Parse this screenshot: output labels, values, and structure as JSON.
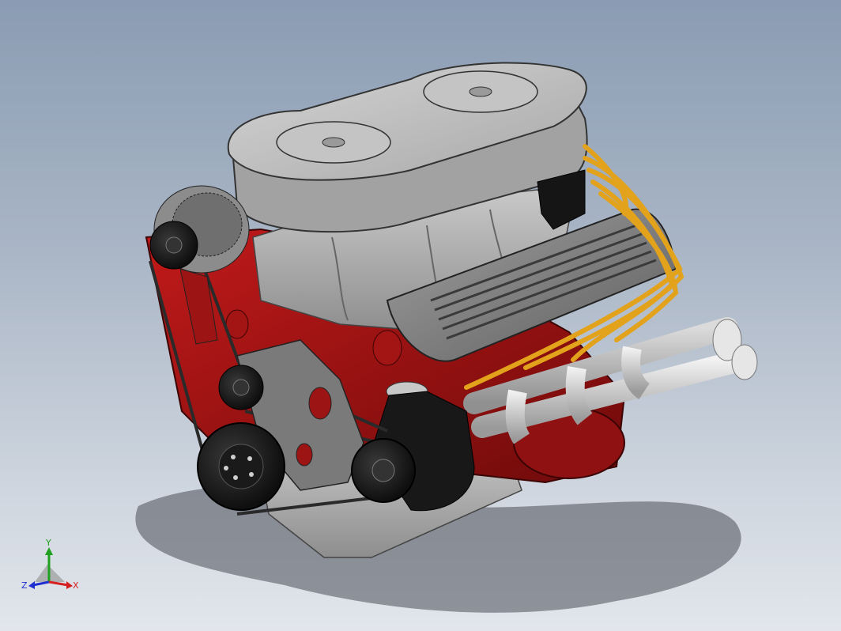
{
  "viewport": {
    "background_top": "#8a9cb3",
    "background_bottom": "#e2e6ec"
  },
  "model": {
    "subject": "v8-engine-assembly",
    "colors": {
      "block": "#9c1414",
      "air_cleaner": "#a9a9a9",
      "valve_cover": "#8f8f8f",
      "pulleys": "#1e1e1e",
      "spark_plug_wires": "#e3a21b",
      "exhaust_headers": "#d9d9d9",
      "shadow": "#4a4f57"
    }
  },
  "triad": {
    "y_label": "Y",
    "z_label": "Z",
    "x_label": "X",
    "colors": {
      "x": "#d42020",
      "y": "#20a020",
      "z": "#2030d0"
    }
  }
}
